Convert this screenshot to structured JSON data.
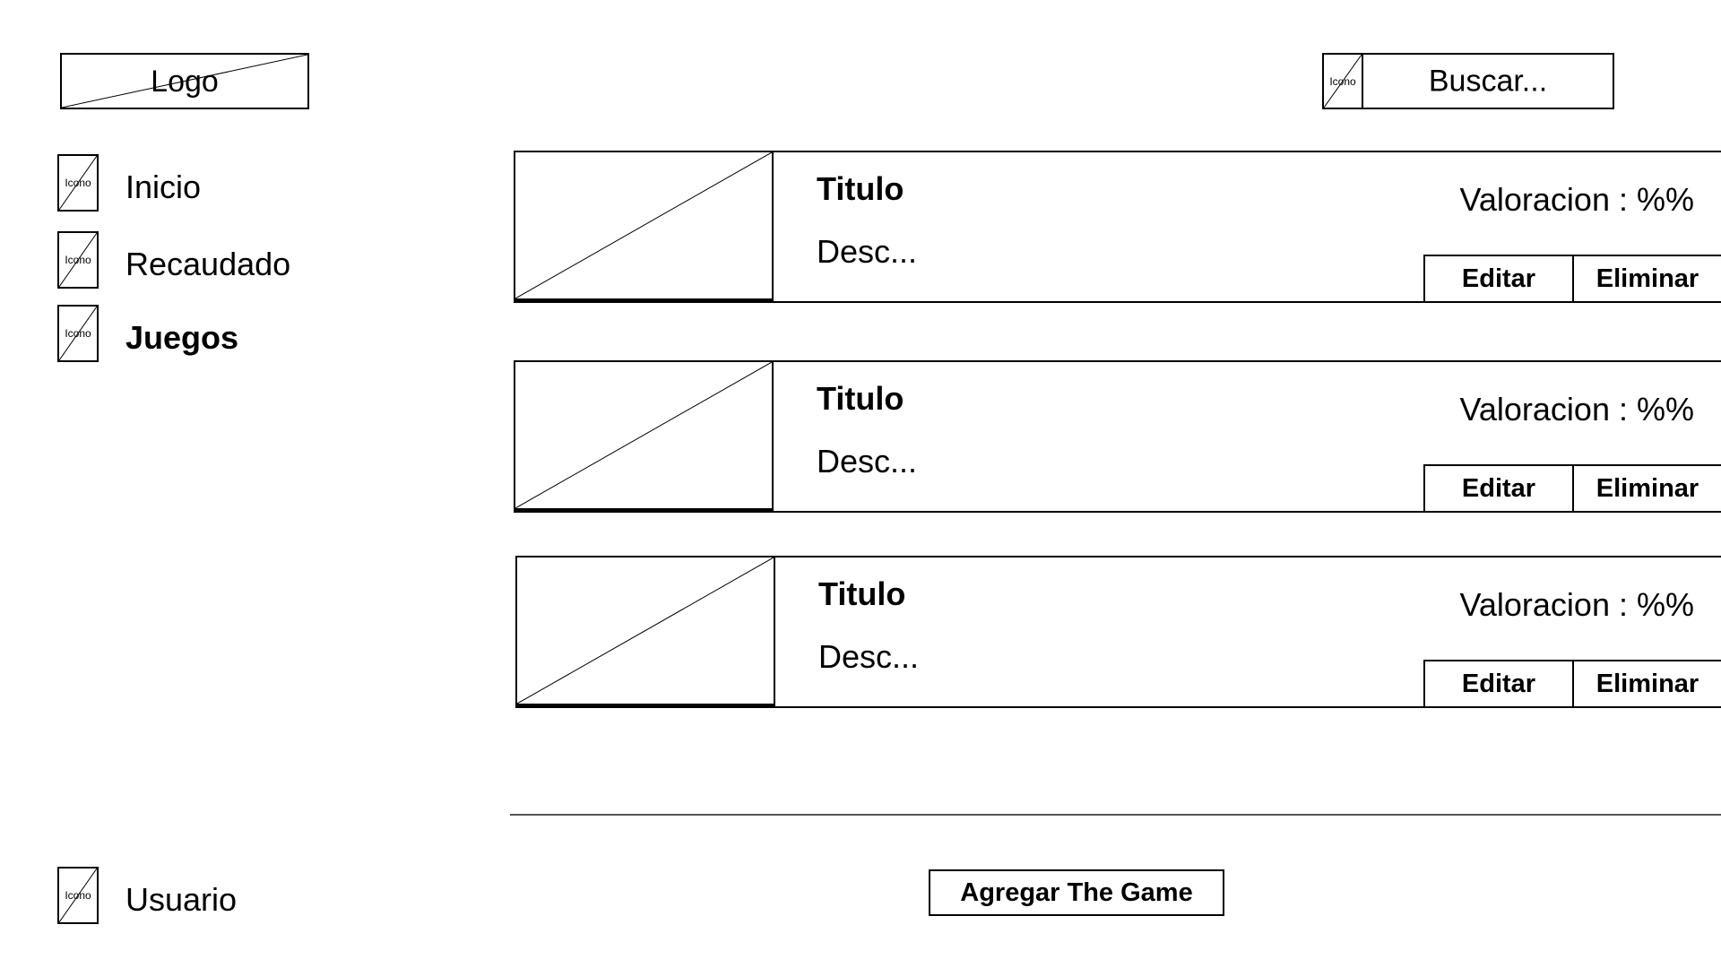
{
  "header": {
    "logo_label": "Logo",
    "search": {
      "icon_label": "Icono",
      "placeholder": "Buscar..."
    }
  },
  "sidebar": {
    "items": [
      {
        "icon_label": "Icono",
        "label": "Inicio"
      },
      {
        "icon_label": "Icono",
        "label": "Recaudado"
      },
      {
        "icon_label": "Icono",
        "label": "Juegos",
        "active": true
      }
    ],
    "user": {
      "icon_label": "Icono",
      "label": "Usuario"
    }
  },
  "games": [
    {
      "title": "Titulo",
      "desc": "Desc...",
      "rating": "Valoracion : %%",
      "edit_label": "Editar",
      "delete_label": "Eliminar"
    },
    {
      "title": "Titulo",
      "desc": "Desc...",
      "rating": "Valoracion : %%",
      "edit_label": "Editar",
      "delete_label": "Eliminar"
    },
    {
      "title": "Titulo",
      "desc": "Desc...",
      "rating": "Valoracion : %%",
      "edit_label": "Editar",
      "delete_label": "Eliminar"
    }
  ],
  "footer": {
    "add_label": "Agregar The Game"
  }
}
